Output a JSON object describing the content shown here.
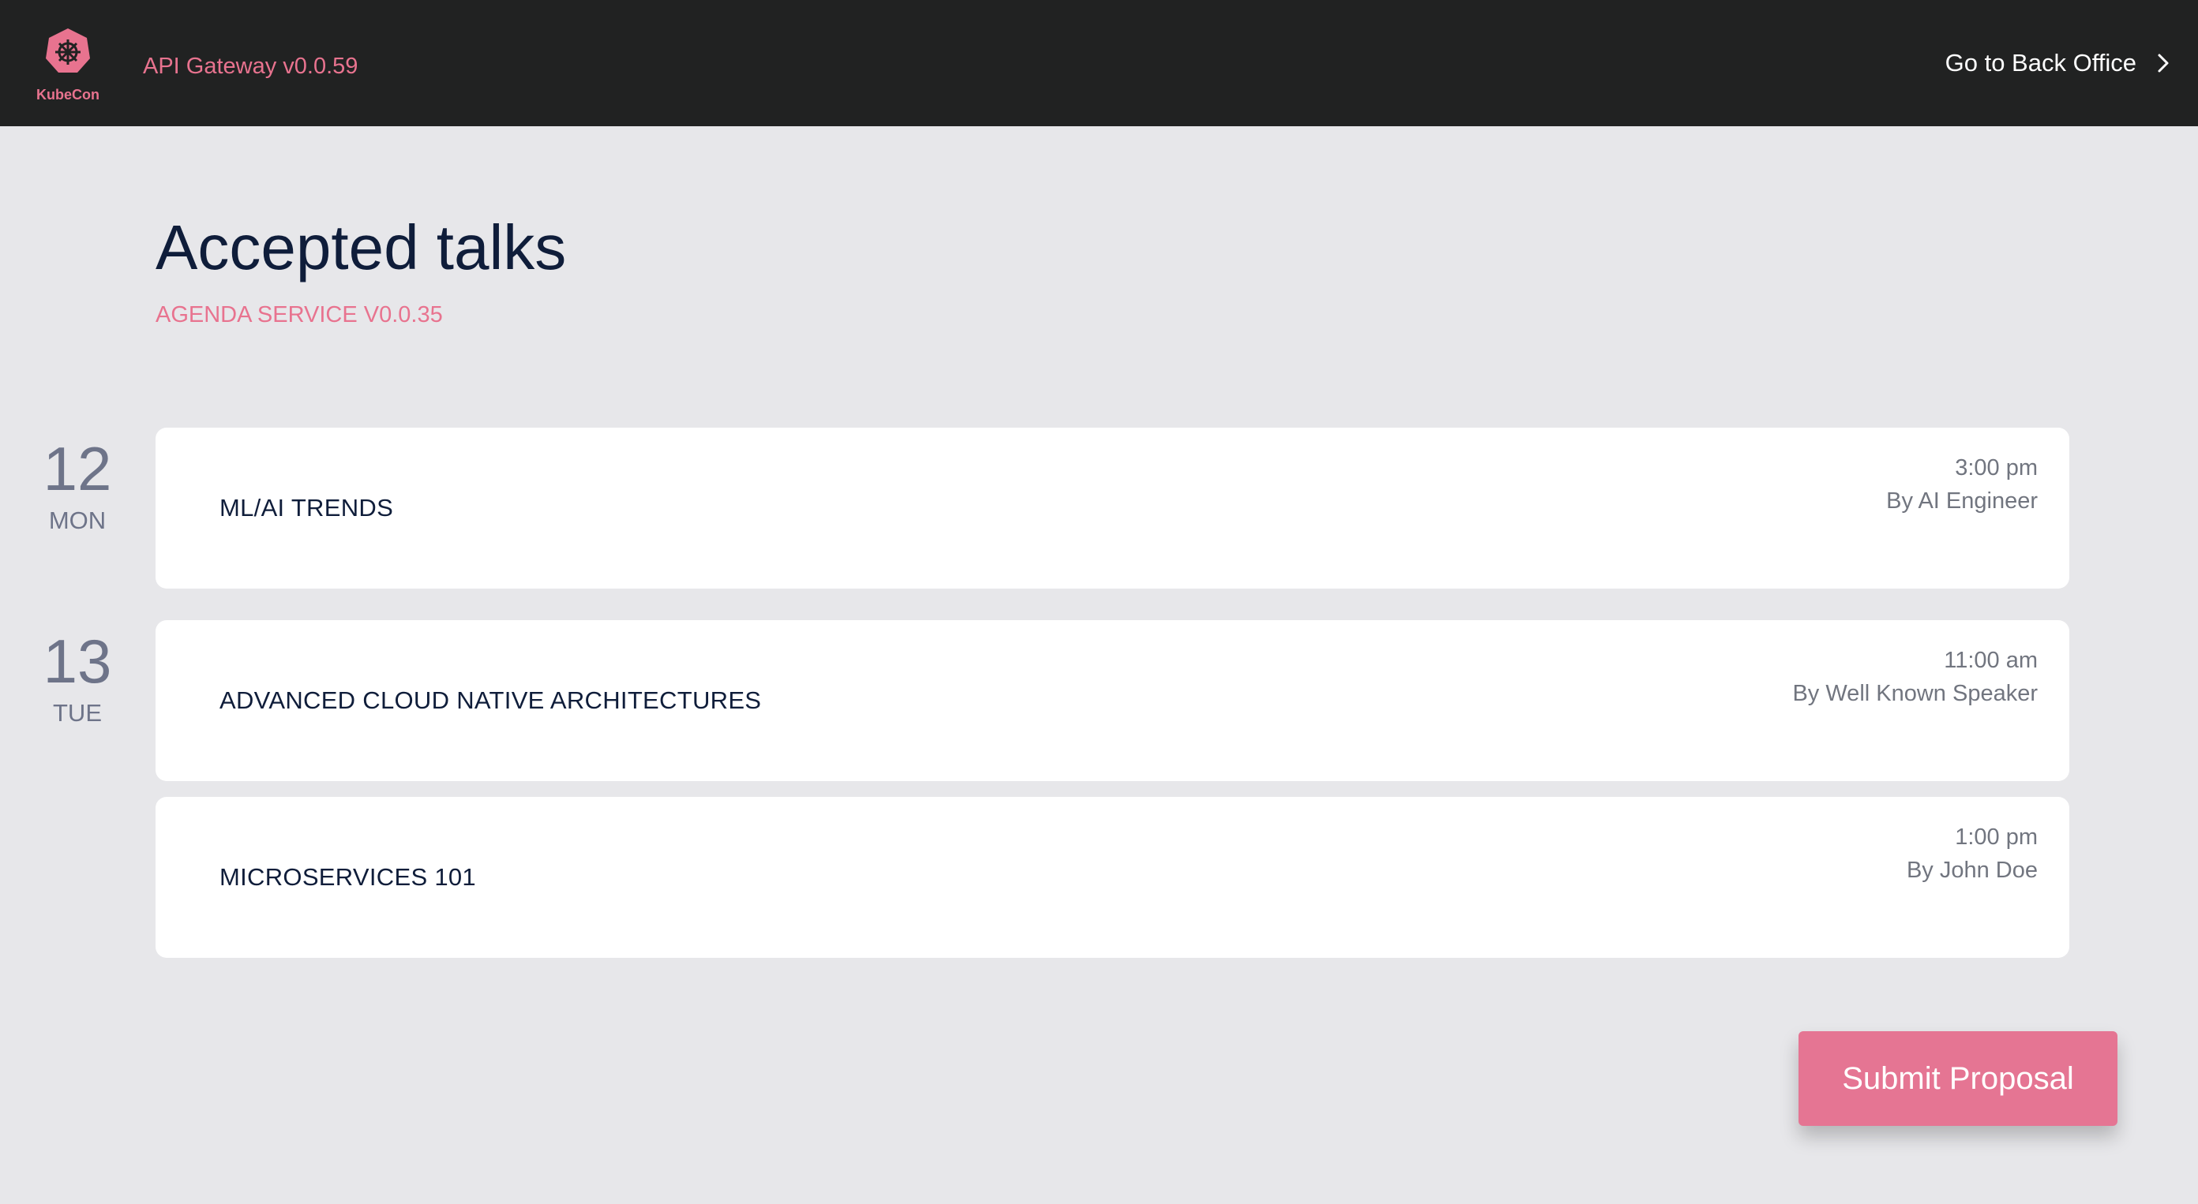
{
  "header": {
    "logo_text": "KubeCon",
    "logo_icon": "kubecon-helm-icon",
    "gateway_version": "API Gateway v0.0.59",
    "back_office_label": "Go to Back Office",
    "back_office_icon": "chevron-right-icon"
  },
  "main": {
    "title": "Accepted talks",
    "service_version": "AGENDA SERVICE V0.0.35"
  },
  "days": [
    {
      "day": "12",
      "weekday": "MON"
    },
    {
      "day": "13",
      "weekday": "TUE"
    }
  ],
  "talks": [
    {
      "title": "ML/AI TRENDS",
      "time": "3:00 pm",
      "speaker": "By AI Engineer"
    },
    {
      "title": "ADVANCED CLOUD NATIVE ARCHITECTURES",
      "time": "11:00 am",
      "speaker": "By Well Known Speaker"
    },
    {
      "title": "MICROSERVICES 101",
      "time": "1:00 pm",
      "speaker": "By John Doe"
    }
  ],
  "actions": {
    "submit_label": "Submit Proposal"
  },
  "colors": {
    "header_bg": "#212222",
    "accent": "#e8738f",
    "page_bg": "#e7e7ea",
    "title_text": "#0f1d3a",
    "button_bg": "#e57593"
  }
}
